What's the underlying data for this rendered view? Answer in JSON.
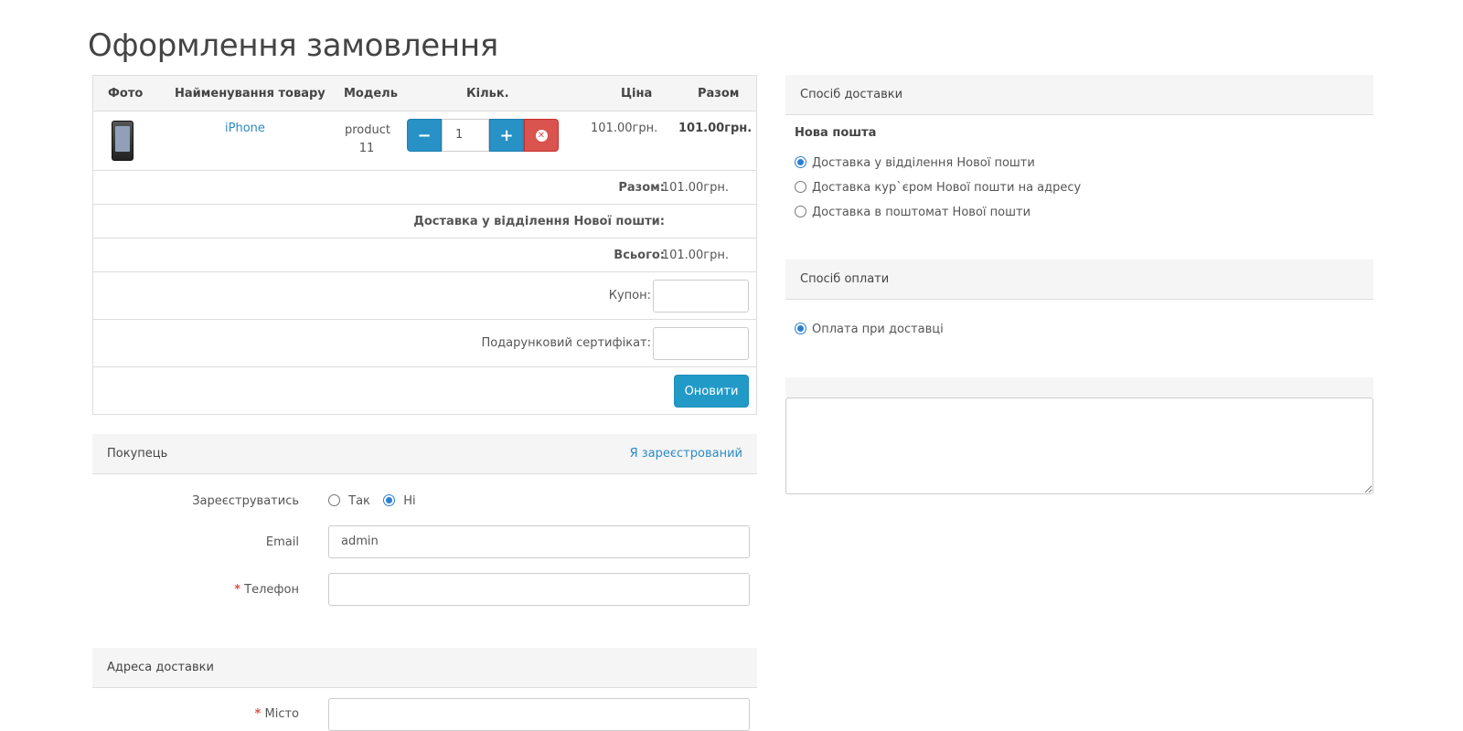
{
  "page": {
    "title": "Оформлення замовлення"
  },
  "cart": {
    "headers": {
      "photo": "Фото",
      "name": "Найменування товару",
      "model": "Модель",
      "qty": "Кільк.",
      "price": "Ціна",
      "total": "Разом"
    },
    "item": {
      "name": "iPhone",
      "model_line1": "product",
      "model_line2": "11",
      "qty": "1",
      "price": "101.00грн.",
      "total": "101.00грн."
    },
    "subtotal_label": "Разом:",
    "subtotal_value": "101.00грн.",
    "shipping_label": "Доставка у відділення Нової пошти:",
    "grand_total_label": "Всього:",
    "grand_total_value": "101.00грн.",
    "coupon_label": "Купон:",
    "voucher_label": "Подарунковий сертифікат:",
    "update_label": "Оновити"
  },
  "customer": {
    "panel_title": "Покупець",
    "login_link": "Я зареєстрований",
    "register_label": "Зареєструватись",
    "register_yes": "Так",
    "register_no": "Ні",
    "email_label": "Email",
    "email_value": "admin",
    "phone_label": "Телефон"
  },
  "address": {
    "panel_title": "Адреса доставки",
    "city_label": "Місто"
  },
  "shipping": {
    "panel_title": "Спосіб доставки",
    "group_title": "Нова пошта",
    "options": [
      "Доставка у відділення Нової пошти",
      "Доставка кур`єром Нової пошти на адресу",
      "Доставка в поштомат Нової пошти"
    ]
  },
  "payment": {
    "panel_title": "Спосіб оплати",
    "options": [
      "Оплата при доставці"
    ]
  },
  "colors": {
    "accent": "#2891c6",
    "danger": "#d9534f",
    "panel_bg": "#f5f5f5",
    "link": "#2a8bc7"
  },
  "icons": {
    "minus": "minus-icon",
    "plus": "plus-icon",
    "remove": "remove-circle-icon"
  }
}
